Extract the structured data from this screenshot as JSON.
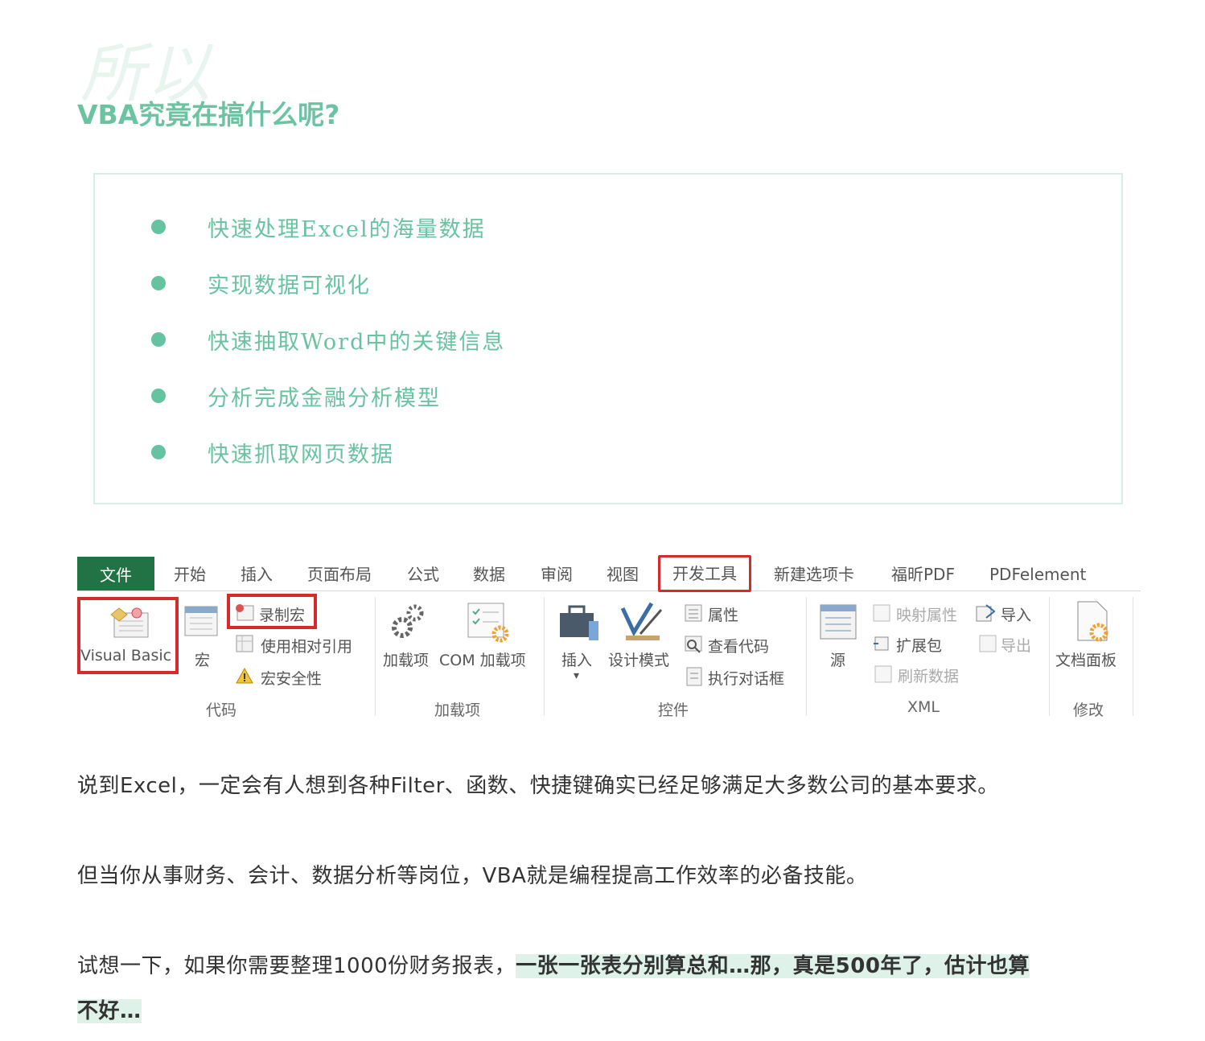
{
  "section": {
    "bg_word": "所以",
    "heading": "VBA究竟在搞什么呢?"
  },
  "features": [
    "快速处理Excel的海量数据",
    "实现数据可视化",
    "快速抽取Word中的关键信息",
    "分析完成金融分析模型",
    "快速抓取网页数据"
  ],
  "ribbon": {
    "tabs": {
      "file": "文件",
      "home": "开始",
      "insert": "插入",
      "layout": "页面布局",
      "formulas": "公式",
      "data": "数据",
      "review": "审阅",
      "view": "视图",
      "developer": "开发工具",
      "new_tab": "新建选项卡",
      "foxit": "福昕PDF",
      "pdfelement": "PDFelement"
    },
    "code": {
      "visual_basic": "Visual Basic",
      "macros": "宏",
      "record_macro": "录制宏",
      "relative_ref": "使用相对引用",
      "macro_security": "宏安全性",
      "group": "代码"
    },
    "addins": {
      "addins": "加载项",
      "com_addins": "COM 加载项",
      "group": "加载项"
    },
    "controls": {
      "insert": "插入",
      "design_mode": "设计模式",
      "properties": "属性",
      "view_code": "查看代码",
      "run_dialog": "执行对话框",
      "group": "控件"
    },
    "xml": {
      "source": "源",
      "map_properties": "映射属性",
      "expansion_packs": "扩展包",
      "refresh_data": "刷新数据",
      "import": "导入",
      "export": "导出",
      "group": "XML"
    },
    "modify": {
      "document_panel": "文档面板",
      "group": "修改"
    }
  },
  "paragraphs": {
    "p1": "说到Excel，一定会有人想到各种Filter、函数、快捷键确实已经足够满足大多数公司的基本要求。",
    "p2": "但当你从事财务、会计、数据分析等岗位，VBA就是编程提高工作效率的必备技能。",
    "p3_normal": "试想一下，如果你需要整理1000份财务报表，",
    "p3_highlight_line1": "一张一张表分别算总和…那，真是500年了，估计也算",
    "p3_highlight_line2": "不好…"
  },
  "colors": {
    "accent": "#6cc3a2",
    "box_border": "#d8efe6",
    "excel_green": "#217346",
    "annotation_red": "#d52b2b",
    "highlight_bg": "#dff2ea"
  }
}
